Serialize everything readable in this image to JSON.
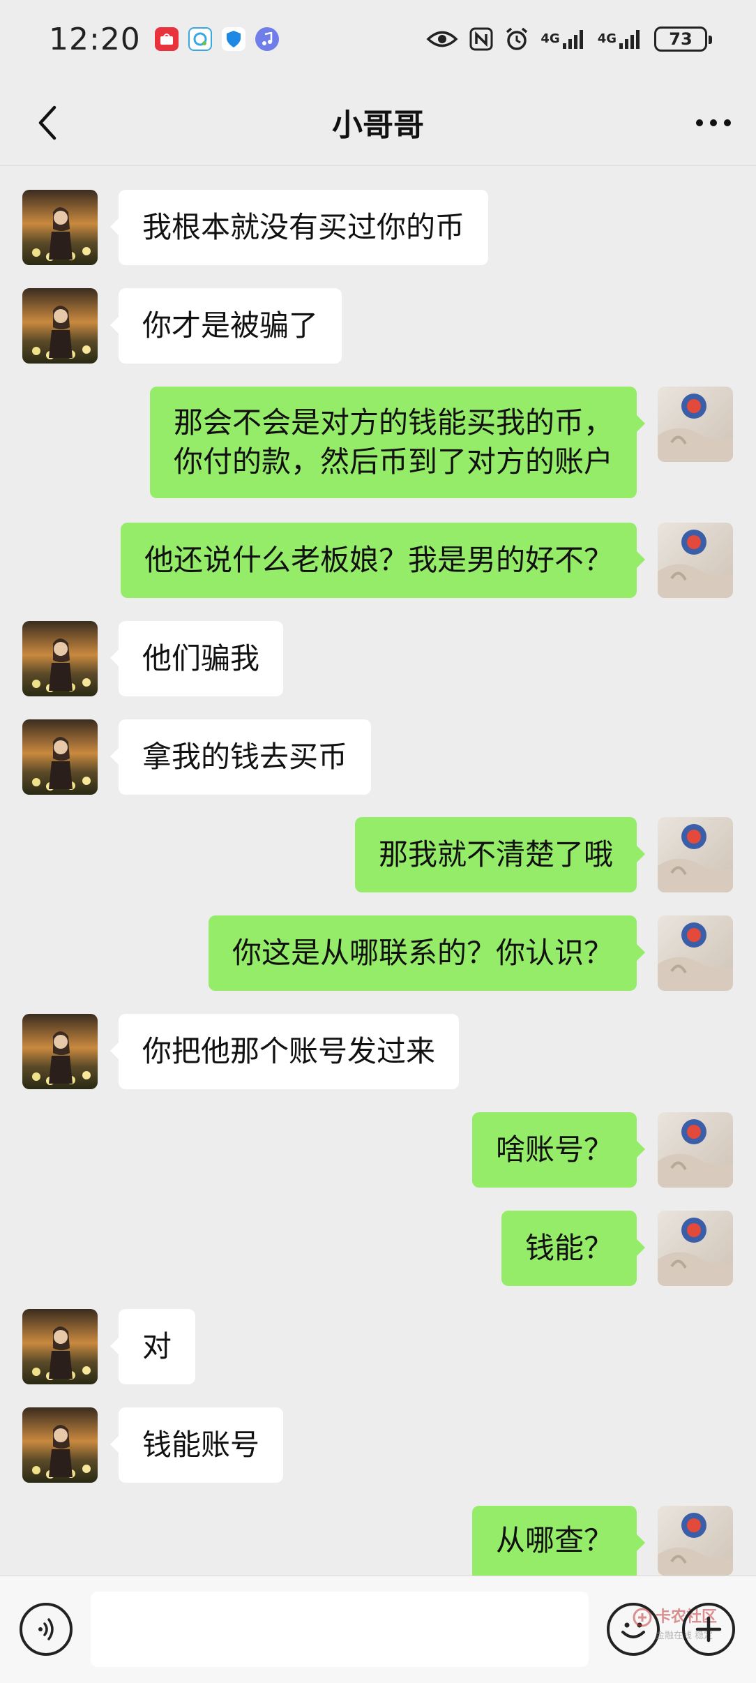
{
  "status_bar": {
    "time": "12:20",
    "net1": "4G",
    "net2": "4G",
    "battery": "73",
    "apps": [
      "huawei-store-icon",
      "weather-chat-icon",
      "shield-app-icon",
      "music-app-icon"
    ]
  },
  "header": {
    "title": "小哥哥"
  },
  "messages": [
    {
      "side": "left",
      "text": "我根本就没有买过你的币"
    },
    {
      "side": "left",
      "text": "你才是被骗了"
    },
    {
      "side": "right",
      "lines": [
        "那会不会是对方的钱能买我的币，",
        "你付的款，然后币到了对方的账户"
      ]
    },
    {
      "side": "right",
      "text": "他还说什么老板娘？我是男的好不？"
    },
    {
      "side": "left",
      "text": "他们骗我"
    },
    {
      "side": "left",
      "text": "拿我的钱去买币"
    },
    {
      "side": "right",
      "text": "那我就不清楚了哦"
    },
    {
      "side": "right",
      "text": "你这是从哪联系的？你认识？"
    },
    {
      "side": "left",
      "text": "你把他那个账号发过来"
    },
    {
      "side": "right",
      "text": "啥账号？"
    },
    {
      "side": "right",
      "text": "钱能？"
    },
    {
      "side": "left",
      "text": "对"
    },
    {
      "side": "left",
      "text": "钱能账号"
    },
    {
      "side": "right",
      "text": "从哪查？"
    }
  ],
  "input_bar": {
    "placeholder": ""
  },
  "watermark": {
    "line1": "卡农社区",
    "line2": "金融在线 稳定"
  },
  "colors": {
    "background": "#ededed",
    "bubble_self": "#95ec69",
    "bubble_other": "#ffffff"
  }
}
